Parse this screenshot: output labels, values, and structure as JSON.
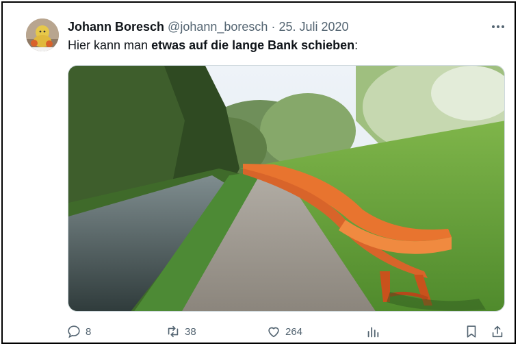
{
  "tweet": {
    "author_name": "Johann Boresch",
    "author_handle": "@johann_boresch",
    "separator": "·",
    "date": "25. Juli 2020",
    "text_plain": "Hier kann man ",
    "text_bold": "etwas auf die lange Bank schieben",
    "text_tail": ":"
  },
  "metrics": {
    "replies": "8",
    "retweets": "38",
    "likes": "264"
  },
  "icons": {
    "more": "more-icon",
    "reply": "reply-icon",
    "retweet": "retweet-icon",
    "like": "heart-icon",
    "views": "analytics-icon",
    "bookmark": "bookmark-icon",
    "share": "share-icon"
  },
  "colors": {
    "text": "#0f1419",
    "secondary": "#536471",
    "bench": "#e8742f"
  }
}
